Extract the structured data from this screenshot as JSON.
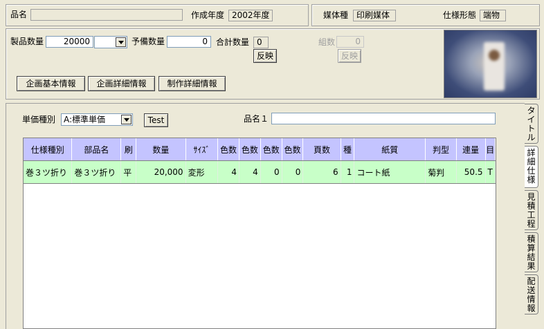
{
  "top": {
    "product_name_label": "品名",
    "product_name_value": "",
    "year_label": "作成年度",
    "year_value": "2002年度",
    "media_label": "媒体種",
    "media_value": "印刷媒体",
    "spec_form_label": "仕様形態",
    "spec_form_value": "端物"
  },
  "quantity": {
    "product_qty_label": "製品数量",
    "product_qty_value": "20000",
    "product_qty_unit": "",
    "spare_qty_label": "予備数量",
    "spare_qty_value": "0",
    "total_qty_label": "合計数量",
    "total_qty_value": "0",
    "set_qty_label": "組数",
    "set_qty_value": "0",
    "reflect_label": "反映",
    "reflect2_label": "反映"
  },
  "buttons": {
    "basic_info": "企画基本情報",
    "detail_info": "企画詳細情報",
    "production_detail": "制作詳細情報",
    "test": "Test"
  },
  "pricing": {
    "unit_type_label": "単価種別",
    "unit_type_value": "A:標準単価",
    "name1_label": "品名１",
    "name1_value": ""
  },
  "grid": {
    "headers": [
      "仕様種別",
      "部品名",
      "刷",
      "数量",
      "ｻｲｽﾞ",
      "色数",
      "色数",
      "色数",
      "色数",
      "頁数",
      "種",
      "紙質",
      "判型",
      "連量",
      "目"
    ],
    "rows": [
      [
        "巻３ツ折り",
        "巻３ツ折り",
        "平",
        "20,000",
        "変形",
        "4",
        "4",
        "0",
        "0",
        "6",
        "1",
        "コート紙",
        "菊判",
        "50.5",
        "T"
      ]
    ]
  },
  "side_tabs": [
    {
      "label": "タイトル",
      "active": false
    },
    {
      "label": "詳細仕様",
      "active": true
    },
    {
      "label": "見積工程",
      "active": false
    },
    {
      "label": "積算結果",
      "active": false
    },
    {
      "label": "配送情報",
      "active": false
    }
  ],
  "icons": {
    "combo_arrow": "chevron-down-icon",
    "thumbnail": "product-thumbnail"
  }
}
